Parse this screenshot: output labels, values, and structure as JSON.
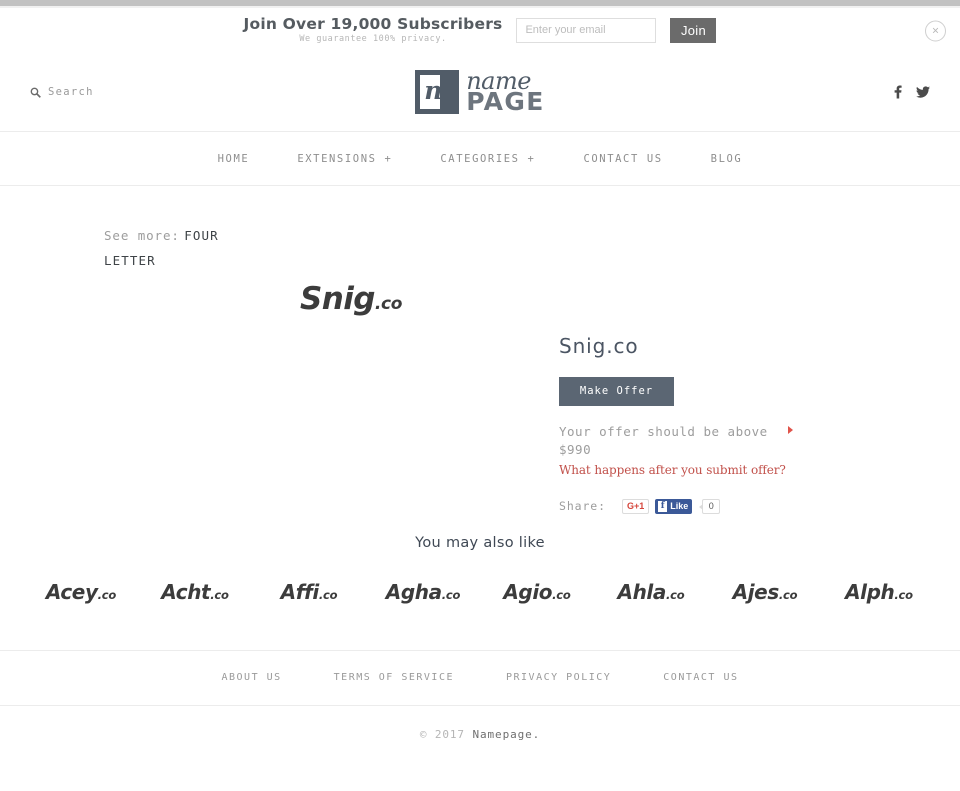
{
  "subscribe": {
    "headline": "Join Over 19,000 Subscribers",
    "subline": "We guarantee 100% privacy.",
    "email_placeholder": "Enter your email",
    "email_value": "",
    "join_label": "Join",
    "close_icon": "×"
  },
  "header": {
    "search_label": "Search",
    "logo": {
      "mark_letter": "n",
      "name": "name",
      "page": "PAGE"
    },
    "social": [
      "facebook-icon",
      "twitter-icon"
    ]
  },
  "nav": {
    "items": [
      {
        "label": "HOME"
      },
      {
        "label": "EXTENSIONS +"
      },
      {
        "label": "CATEGORIES +"
      },
      {
        "label": "CONTACT US"
      },
      {
        "label": "BLOG"
      }
    ]
  },
  "seemore": {
    "label": "See more:",
    "link": "FOUR LETTER"
  },
  "product": {
    "art_name": "Snig",
    "art_tld": ".co",
    "title": "Snig.co",
    "offer_button": "Make Offer",
    "offer_note": "Your offer should be above $990",
    "offer_link": "What happens after you submit offer?",
    "share_label": "Share:",
    "gplus_label": "G+1",
    "fb_f": "f",
    "fb_like_label": "Like",
    "fb_count": "0"
  },
  "alsolike": {
    "heading": "You may also like",
    "items": [
      {
        "name": "Acey",
        "tld": ".co"
      },
      {
        "name": "Acht",
        "tld": ".co"
      },
      {
        "name": "Affi",
        "tld": ".co"
      },
      {
        "name": "Agha",
        "tld": ".co"
      },
      {
        "name": "Agio",
        "tld": ".co"
      },
      {
        "name": "Ahla",
        "tld": ".co"
      },
      {
        "name": "Ajes",
        "tld": ".co"
      },
      {
        "name": "Alph",
        "tld": ".co"
      }
    ]
  },
  "footer": {
    "links": [
      {
        "label": "ABOUT US"
      },
      {
        "label": "TERMS OF SERVICE"
      },
      {
        "label": "PRIVACY POLICY"
      },
      {
        "label": "CONTACT US"
      }
    ],
    "copyright_prefix": "© 2017 ",
    "copyright_brand": "Namepage."
  },
  "colors": {
    "logo_mark": "#515c68",
    "offer_button": "#5b6673",
    "accent_red": "#c1504a",
    "arrow_red": "#e0534a",
    "facebook_blue": "#3b5998",
    "gplus_red": "#d5453b",
    "join_button": "#6b6b6b"
  }
}
